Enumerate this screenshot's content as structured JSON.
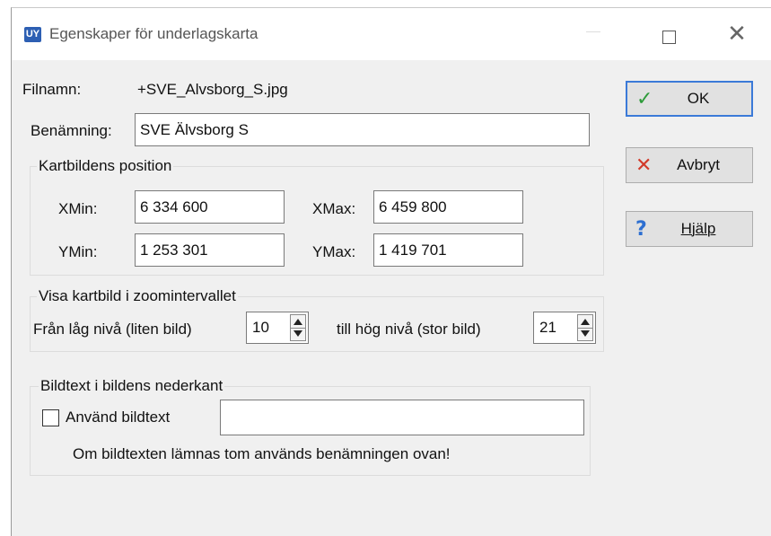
{
  "window": {
    "title": "Egenskaper för underlagskarta",
    "app_icon": "map-app-icon"
  },
  "file": {
    "filename_label": "Filnamn:",
    "filename_value": "+SVE_Alvsborg_S.jpg",
    "name_label": "Benämning:",
    "name_value": "SVE Älvsborg S"
  },
  "position": {
    "legend": "Kartbildens position",
    "xmin_label": "XMin:",
    "xmin_value": "6 334 600",
    "xmax_label": "XMax:",
    "xmax_value": "6 459 800",
    "ymin_label": "YMin:",
    "ymin_value": "1 253 301",
    "ymax_label": "YMax:",
    "ymax_value": "1 419 701"
  },
  "zoom": {
    "legend": "Visa kartbild i zoomintervallet",
    "from_label": "Från låg nivå (liten bild)",
    "from_value": "10",
    "to_label": "till hög nivå (stor bild)",
    "to_value": "21"
  },
  "caption": {
    "legend": "Bildtext i bildens nederkant",
    "checkbox_label": "Använd bildtext",
    "checked": false,
    "text_value": "",
    "note": "Om bildtexten lämnas tom används benämningen ovan!"
  },
  "buttons": {
    "ok_label": "OK",
    "cancel_label": "Avbryt",
    "help_label": "Hjälp",
    "ok_icon": "checkmark-icon",
    "cancel_icon": "cross-icon",
    "help_icon": "question-icon",
    "ok_icon_color": "#2e9b3a",
    "cancel_icon_color": "#d23a2a",
    "help_icon_color": "#2d6fd1"
  }
}
